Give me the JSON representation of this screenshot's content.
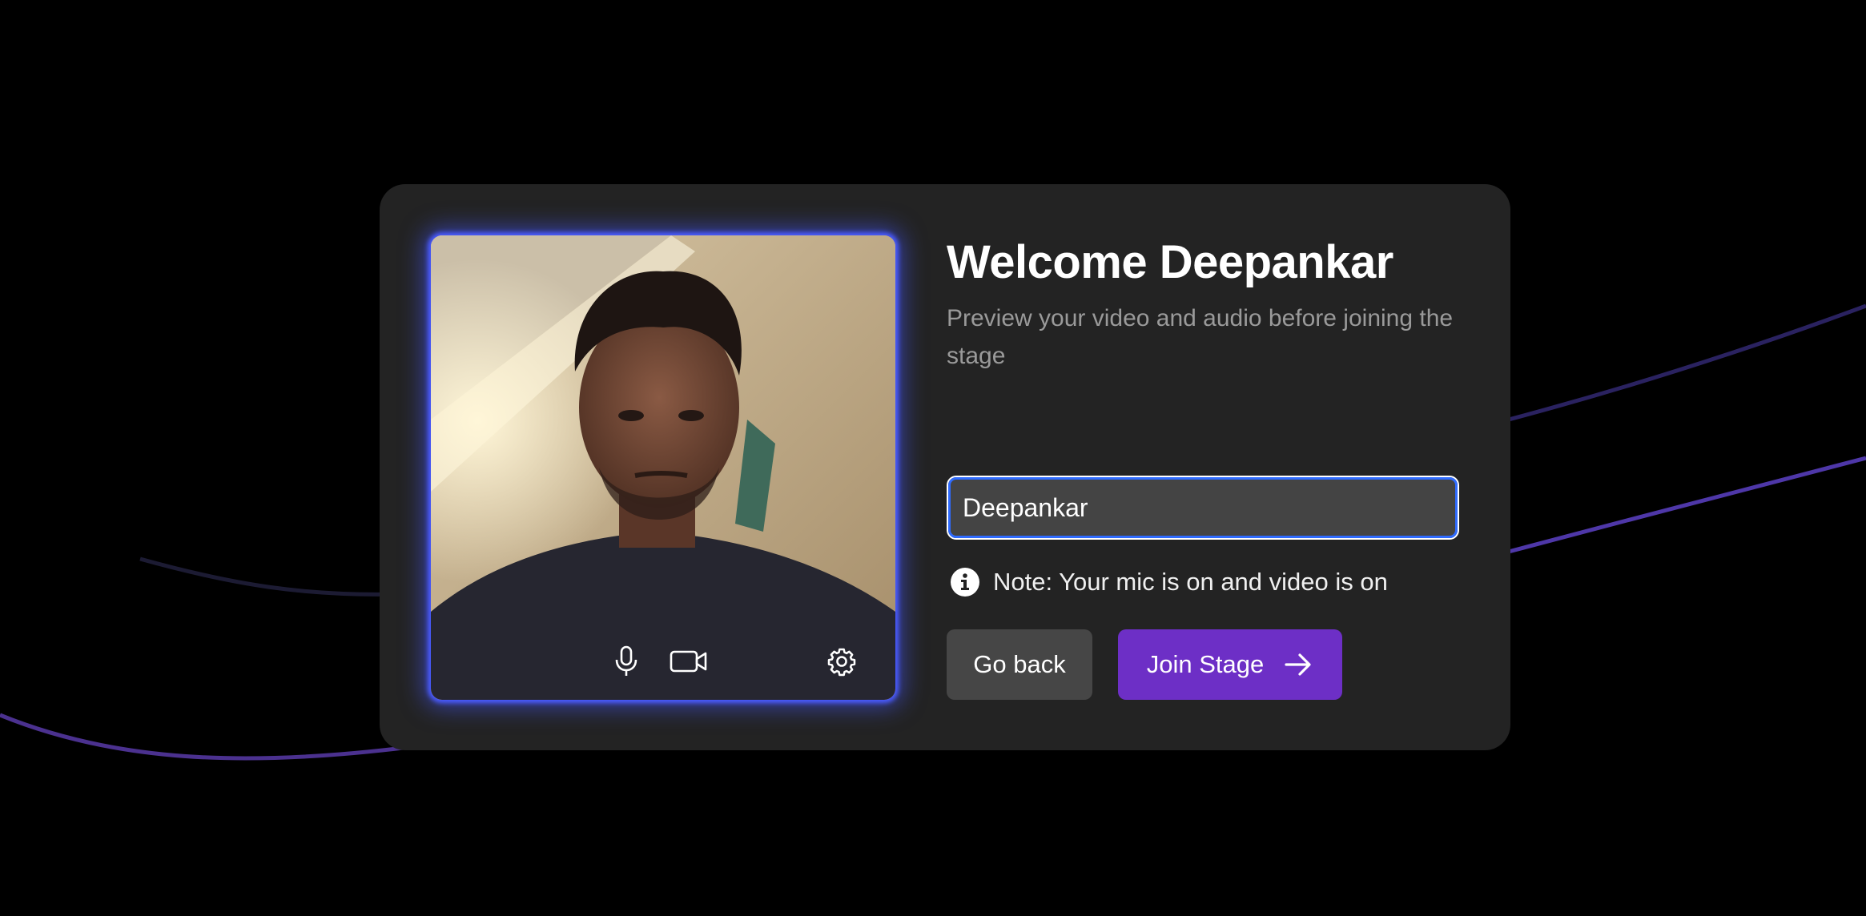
{
  "welcome": {
    "title": "Welcome Deepankar",
    "subtitle": "Preview your video and audio before joining the stage"
  },
  "name_field": {
    "value": "Deepankar"
  },
  "note": {
    "text": "Note: Your mic is on and video is on",
    "icon": "info-icon"
  },
  "preview": {
    "controls": [
      {
        "icon": "microphone-icon"
      },
      {
        "icon": "video-camera-icon"
      },
      {
        "icon": "gear-icon"
      }
    ],
    "glow_color": "#4a5bff"
  },
  "actions": {
    "back_label": "Go back",
    "join_label": "Join Stage",
    "join_icon": "arrow-right-icon"
  },
  "colors": {
    "background": "#000000",
    "card": "#232323",
    "input_bg": "#444444",
    "input_focus": "#2f6bff",
    "primary": "#6d2fc6",
    "secondary": "#464646",
    "decorative_lines": "#5b3fb0"
  }
}
